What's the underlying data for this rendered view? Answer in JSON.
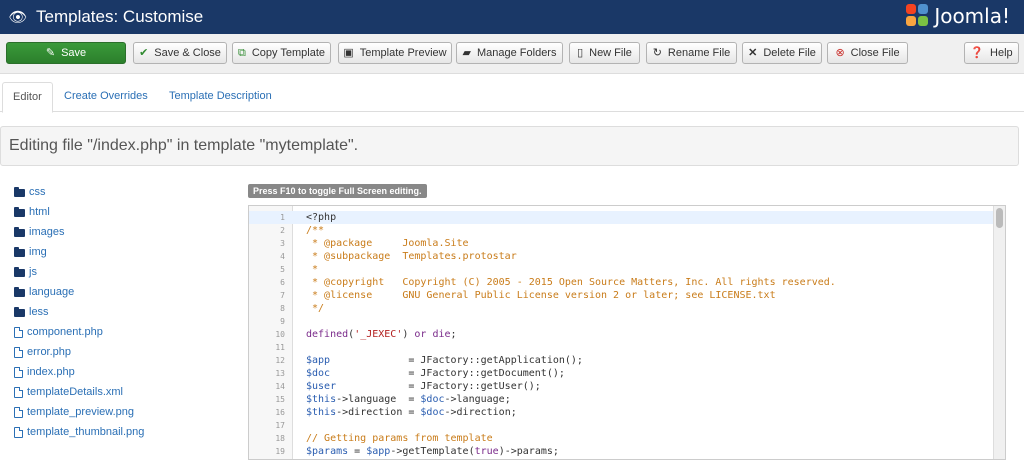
{
  "header": {
    "title": "Templates: Customise",
    "brand": "Joomla!"
  },
  "toolbar": {
    "save": "Save",
    "save_close": "Save & Close",
    "copy_template": "Copy Template",
    "template_preview": "Template Preview",
    "manage_folders": "Manage Folders",
    "new_file": "New File",
    "rename_file": "Rename File",
    "delete_file": "Delete File",
    "close_file": "Close File",
    "help": "Help"
  },
  "tabs": {
    "editor": "Editor",
    "overrides": "Create Overrides",
    "description": "Template Description"
  },
  "banner": "Editing file \"/index.php\" in template \"mytemplate\".",
  "files": {
    "folders": [
      "css",
      "html",
      "images",
      "img",
      "js",
      "language",
      "less"
    ],
    "files": [
      "component.php",
      "error.php",
      "index.php",
      "templateDetails.xml",
      "template_preview.png",
      "template_thumbnail.png"
    ]
  },
  "hint": "Press F10 to toggle Full Screen editing.",
  "code": [
    "<?php",
    "/**",
    " * @package     Joomla.Site",
    " * @subpackage  Templates.protostar",
    " *",
    " * @copyright   Copyright (C) 2005 - 2015 Open Source Matters, Inc. All rights reserved.",
    " * @license     GNU General Public License version 2 or later; see LICENSE.txt",
    " */",
    "",
    "defined('_JEXEC') or die;",
    "",
    "$app             = JFactory::getApplication();",
    "$doc             = JFactory::getDocument();",
    "$user            = JFactory::getUser();",
    "$this->language  = $doc->language;",
    "$this->direction = $doc->direction;",
    "",
    "// Getting params from template",
    "$params = $app->getTemplate(true)->params;"
  ],
  "colors": {
    "header": "#1a3867",
    "save": "#2f8a2f",
    "link": "#2a6fb5",
    "comment": "#c97c1a",
    "keyword": "#7a2a8a",
    "string": "#b32020",
    "variable": "#2a5db0"
  }
}
